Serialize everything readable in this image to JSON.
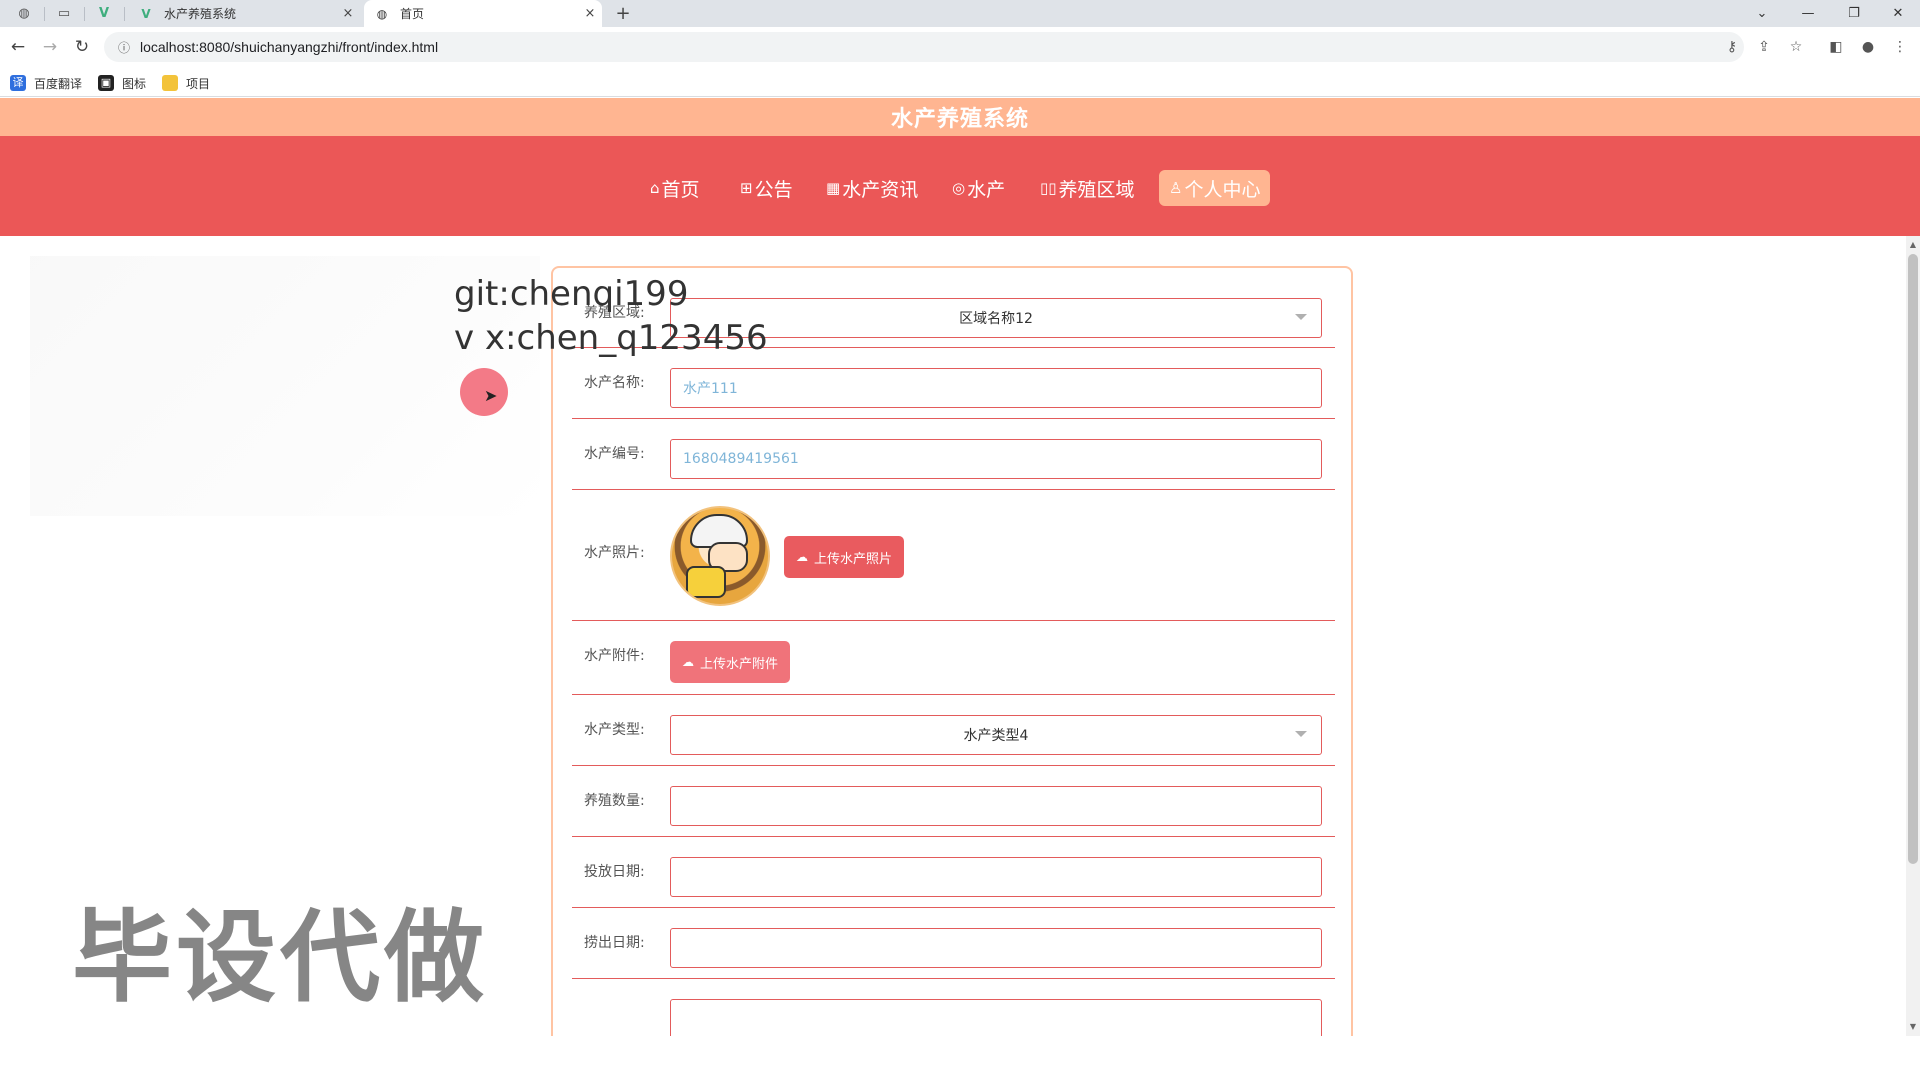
{
  "browser": {
    "tabs": [
      {
        "title": "水产养殖系统",
        "favicon": "vue-logo-icon",
        "active": false
      },
      {
        "title": "首页",
        "favicon": "globe-icon",
        "active": true
      }
    ],
    "pinned_icons": [
      "globe-icon",
      "blank-page-icon",
      "vue-logo-icon"
    ],
    "close_glyph": "×",
    "new_tab_glyph": "+",
    "url": "localhost:8080/shuichanyangzhi/front/index.html",
    "bookmarks": [
      {
        "label": "百度翻译",
        "icon": "translate-icon",
        "color": "#2f6fde"
      },
      {
        "label": "图标",
        "icon": "image-icon",
        "color": "#222222"
      },
      {
        "label": "项目",
        "icon": "folder-icon",
        "color": "#f3c33a"
      }
    ]
  },
  "site": {
    "title": "水产养殖系统",
    "colors": {
      "title_bar": "#ffb591",
      "nav_bar": "#eb5757",
      "accent": "#e95b5f"
    },
    "nav": [
      {
        "label": "首页",
        "icon": "home-icon",
        "active": false
      },
      {
        "label": "公告",
        "icon": "gift-icon",
        "active": false
      },
      {
        "label": "水产资讯",
        "icon": "grid-icon",
        "active": false
      },
      {
        "label": "水产",
        "icon": "fish-icon",
        "active": false
      },
      {
        "label": "养殖区域",
        "icon": "columns-icon",
        "active": false
      },
      {
        "label": "个人中心",
        "icon": "user-icon",
        "active": true
      }
    ]
  },
  "overlay": {
    "line1": "git:chenqi199",
    "line2": "v x:chen_q123456",
    "big": "毕设代做"
  },
  "form": {
    "area": {
      "label": "养殖区域:",
      "value": "区域名称12"
    },
    "name": {
      "label": "水产名称:",
      "value": "水产111"
    },
    "code": {
      "label": "水产编号:",
      "value": "1680489419561"
    },
    "photo": {
      "label": "水产照片:",
      "button": "上传水产照片"
    },
    "attachment": {
      "label": "水产附件:",
      "button": "上传水产附件"
    },
    "type": {
      "label": "水产类型:",
      "value": "水产类型4"
    },
    "quantity": {
      "label": "养殖数量:",
      "value": ""
    },
    "release_date": {
      "label": "投放日期:",
      "value": ""
    },
    "harvest_date": {
      "label": "捞出日期:",
      "value": ""
    }
  }
}
